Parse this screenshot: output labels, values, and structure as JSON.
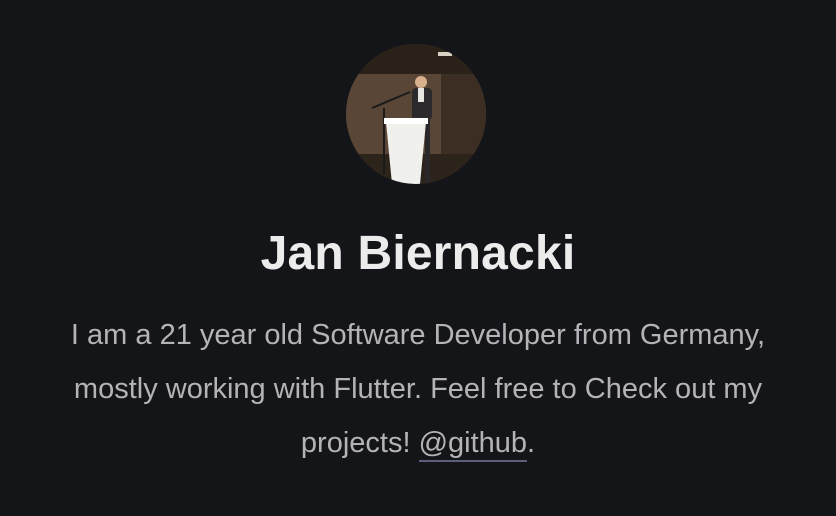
{
  "profile": {
    "name": "Jan Biernacki",
    "avatar_icon": "profile-photo-speaker-at-podium",
    "bio": {
      "line1": "I am a 21 year old Software Developer from Germany,",
      "line2": "mostly working with Flutter. Feel free to Check out my",
      "line3_prefix": "projects! ",
      "link_text": "@github",
      "line3_suffix": "."
    }
  },
  "colors": {
    "background": "#141518",
    "name_text": "#ececec",
    "bio_text": "#b4b3b8",
    "link_underline": "#5a5f7a"
  }
}
